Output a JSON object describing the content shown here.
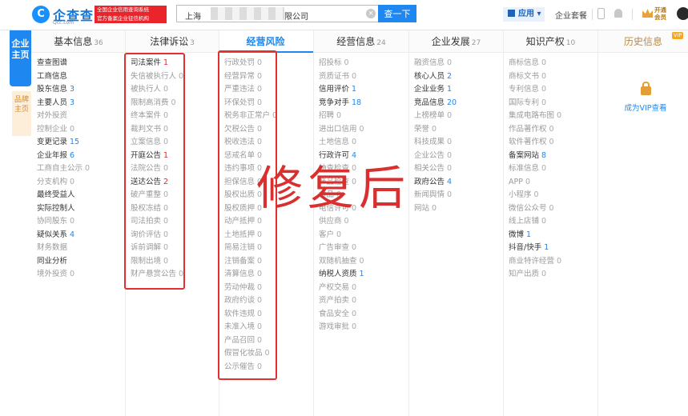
{
  "header": {
    "logo_mark": "C",
    "logo_text": "企查查",
    "logo_sub": "Qcc.com",
    "slogan_lines": [
      "全国企业信用查询系统",
      "官方备案企业征信机构"
    ],
    "search_value_prefix": "上海",
    "search_value_suffix": "有限公司",
    "search_button": "查一下",
    "app_menu": "应用",
    "package_link": "企业套餐",
    "vip_open": "开通会员"
  },
  "side_tabs": {
    "main": "企业主页",
    "brand": "品牌主页"
  },
  "columns": [
    {
      "title": "基本信息",
      "count": "36",
      "active": false,
      "items": [
        {
          "label": "查查图谱",
          "num": "",
          "dim": false,
          "style": ""
        },
        {
          "label": "工商信息",
          "num": "",
          "dim": false,
          "style": ""
        },
        {
          "label": "股东信息",
          "num": "3",
          "dim": false,
          "style": "hl"
        },
        {
          "label": "主要人员",
          "num": "3",
          "dim": false,
          "style": "hl"
        },
        {
          "label": "对外投资",
          "num": "",
          "dim": true,
          "style": ""
        },
        {
          "label": "控制企业",
          "num": "0",
          "dim": true,
          "style": ""
        },
        {
          "label": "变更记录",
          "num": "15",
          "dim": false,
          "style": "hl"
        },
        {
          "label": "企业年报",
          "num": "6",
          "dim": false,
          "style": "hl"
        },
        {
          "label": "工商自主公示",
          "num": "0",
          "dim": true,
          "style": ""
        },
        {
          "label": "分支机构",
          "num": "0",
          "dim": true,
          "style": ""
        },
        {
          "label": "最终受益人",
          "num": "",
          "dim": false,
          "style": ""
        },
        {
          "label": "实际控制人",
          "num": "",
          "dim": false,
          "style": ""
        },
        {
          "label": "协同股东",
          "num": "0",
          "dim": true,
          "style": ""
        },
        {
          "label": "疑似关系",
          "num": "4",
          "dim": false,
          "style": "hl"
        },
        {
          "label": "财务数据",
          "num": "",
          "dim": true,
          "style": ""
        },
        {
          "label": "同业分析",
          "num": "",
          "dim": false,
          "style": ""
        },
        {
          "label": "境外投资",
          "num": "0",
          "dim": true,
          "style": ""
        }
      ]
    },
    {
      "title": "法律诉讼",
      "count": "3",
      "active": false,
      "items": [
        {
          "label": "司法案件",
          "num": "1",
          "dim": false,
          "style": "red"
        },
        {
          "label": "失信被执行人",
          "num": "0",
          "dim": true,
          "style": ""
        },
        {
          "label": "被执行人",
          "num": "0",
          "dim": true,
          "style": ""
        },
        {
          "label": "限制高消费",
          "num": "0",
          "dim": true,
          "style": ""
        },
        {
          "label": "终本案件",
          "num": "0",
          "dim": true,
          "style": ""
        },
        {
          "label": "裁判文书",
          "num": "0",
          "dim": true,
          "style": ""
        },
        {
          "label": "立案信息",
          "num": "0",
          "dim": true,
          "style": ""
        },
        {
          "label": "开庭公告",
          "num": "1",
          "dim": false,
          "style": "red"
        },
        {
          "label": "法院公告",
          "num": "0",
          "dim": true,
          "style": ""
        },
        {
          "label": "送达公告",
          "num": "2",
          "dim": false,
          "style": "red"
        },
        {
          "label": "破产重整",
          "num": "0",
          "dim": true,
          "style": ""
        },
        {
          "label": "股权冻结",
          "num": "0",
          "dim": true,
          "style": ""
        },
        {
          "label": "司法拍卖",
          "num": "0",
          "dim": true,
          "style": ""
        },
        {
          "label": "询价评估",
          "num": "0",
          "dim": true,
          "style": ""
        },
        {
          "label": "诉前调解",
          "num": "0",
          "dim": true,
          "style": ""
        },
        {
          "label": "限制出境",
          "num": "0",
          "dim": true,
          "style": ""
        },
        {
          "label": "财产悬赏公告",
          "num": "0",
          "dim": true,
          "style": ""
        }
      ]
    },
    {
      "title": "经营风险",
      "count": "",
      "active": true,
      "items": [
        {
          "label": "行政处罚",
          "num": "0",
          "dim": true,
          "style": ""
        },
        {
          "label": "经营异常",
          "num": "0",
          "dim": true,
          "style": ""
        },
        {
          "label": "严重违法",
          "num": "0",
          "dim": true,
          "style": ""
        },
        {
          "label": "环保处罚",
          "num": "0",
          "dim": true,
          "style": ""
        },
        {
          "label": "税务非正常户",
          "num": "0",
          "dim": true,
          "style": ""
        },
        {
          "label": "欠税公告",
          "num": "0",
          "dim": true,
          "style": ""
        },
        {
          "label": "税收违法",
          "num": "0",
          "dim": true,
          "style": ""
        },
        {
          "label": "惩戒名单",
          "num": "0",
          "dim": true,
          "style": ""
        },
        {
          "label": "违约事项",
          "num": "0",
          "dim": true,
          "style": ""
        },
        {
          "label": "担保信息",
          "num": "0",
          "dim": true,
          "style": ""
        },
        {
          "label": "股权出质",
          "num": "0",
          "dim": true,
          "style": ""
        },
        {
          "label": "股权质押",
          "num": "0",
          "dim": true,
          "style": ""
        },
        {
          "label": "动产抵押",
          "num": "0",
          "dim": true,
          "style": ""
        },
        {
          "label": "土地抵押",
          "num": "0",
          "dim": true,
          "style": ""
        },
        {
          "label": "简易注销",
          "num": "0",
          "dim": true,
          "style": ""
        },
        {
          "label": "注销备案",
          "num": "0",
          "dim": true,
          "style": ""
        },
        {
          "label": "清算信息",
          "num": "0",
          "dim": true,
          "style": ""
        },
        {
          "label": "劳动仲裁",
          "num": "0",
          "dim": true,
          "style": ""
        },
        {
          "label": "政府约谈",
          "num": "0",
          "dim": true,
          "style": ""
        },
        {
          "label": "软件违规",
          "num": "0",
          "dim": true,
          "style": ""
        },
        {
          "label": "未准入境",
          "num": "0",
          "dim": true,
          "style": ""
        },
        {
          "label": "产品召回",
          "num": "0",
          "dim": true,
          "style": ""
        },
        {
          "label": "假冒化妆品",
          "num": "0",
          "dim": true,
          "style": ""
        },
        {
          "label": "公示催告",
          "num": "0",
          "dim": true,
          "style": ""
        }
      ]
    },
    {
      "title": "经营信息",
      "count": "24",
      "active": false,
      "items": [
        {
          "label": "招投标",
          "num": "0",
          "dim": true,
          "style": ""
        },
        {
          "label": "资质证书",
          "num": "0",
          "dim": true,
          "style": ""
        },
        {
          "label": "信用评价",
          "num": "1",
          "dim": false,
          "style": "hl"
        },
        {
          "label": "竞争对手",
          "num": "18",
          "dim": false,
          "style": "hl"
        },
        {
          "label": "招聘",
          "num": "0",
          "dim": true,
          "style": ""
        },
        {
          "label": "进出口信用",
          "num": "0",
          "dim": true,
          "style": ""
        },
        {
          "label": "土地信息",
          "num": "0",
          "dim": true,
          "style": ""
        },
        {
          "label": "行政许可",
          "num": "4",
          "dim": false,
          "style": "hl"
        },
        {
          "label": "抽查检查",
          "num": "0",
          "dim": true,
          "style": ""
        },
        {
          "label": "产品检查",
          "num": "0",
          "dim": true,
          "style": ""
        },
        {
          "label": "食品",
          "num": "0",
          "dim": true,
          "style": ""
        },
        {
          "label": "电信许可",
          "num": "0",
          "dim": true,
          "style": ""
        },
        {
          "label": "供应商",
          "num": "0",
          "dim": true,
          "style": ""
        },
        {
          "label": "客户",
          "num": "0",
          "dim": true,
          "style": ""
        },
        {
          "label": "广告审查",
          "num": "0",
          "dim": true,
          "style": ""
        },
        {
          "label": "双随机抽查",
          "num": "0",
          "dim": true,
          "style": ""
        },
        {
          "label": "纳税人资质",
          "num": "1",
          "dim": false,
          "style": "hl"
        },
        {
          "label": "产权交易",
          "num": "0",
          "dim": true,
          "style": ""
        },
        {
          "label": "资产拍卖",
          "num": "0",
          "dim": true,
          "style": ""
        },
        {
          "label": "食品安全",
          "num": "0",
          "dim": true,
          "style": ""
        },
        {
          "label": "游戏审批",
          "num": "0",
          "dim": true,
          "style": ""
        }
      ]
    },
    {
      "title": "企业发展",
      "count": "27",
      "active": false,
      "items": [
        {
          "label": "融资信息",
          "num": "0",
          "dim": true,
          "style": ""
        },
        {
          "label": "核心人员",
          "num": "2",
          "dim": false,
          "style": "hl"
        },
        {
          "label": "企业业务",
          "num": "1",
          "dim": false,
          "style": "hl"
        },
        {
          "label": "竞品信息",
          "num": "20",
          "dim": false,
          "style": "hl"
        },
        {
          "label": "上榜榜单",
          "num": "0",
          "dim": true,
          "style": ""
        },
        {
          "label": "荣誉",
          "num": "0",
          "dim": true,
          "style": ""
        },
        {
          "label": "科技成果",
          "num": "0",
          "dim": true,
          "style": ""
        },
        {
          "label": "企业公告",
          "num": "0",
          "dim": true,
          "style": ""
        },
        {
          "label": "相关公告",
          "num": "0",
          "dim": true,
          "style": ""
        },
        {
          "label": "政府公告",
          "num": "4",
          "dim": false,
          "style": "hl"
        },
        {
          "label": "新闻舆情",
          "num": "0",
          "dim": true,
          "style": ""
        },
        {
          "label": "网站",
          "num": "0",
          "dim": true,
          "style": ""
        }
      ]
    },
    {
      "title": "知识产权",
      "count": "10",
      "active": false,
      "items": [
        {
          "label": "商标信息",
          "num": "0",
          "dim": true,
          "style": ""
        },
        {
          "label": "商标文书",
          "num": "0",
          "dim": true,
          "style": ""
        },
        {
          "label": "专利信息",
          "num": "0",
          "dim": true,
          "style": ""
        },
        {
          "label": "国际专利",
          "num": "0",
          "dim": true,
          "style": ""
        },
        {
          "label": "集成电路布图",
          "num": "0",
          "dim": true,
          "style": ""
        },
        {
          "label": "作品著作权",
          "num": "0",
          "dim": true,
          "style": ""
        },
        {
          "label": "软件著作权",
          "num": "0",
          "dim": true,
          "style": ""
        },
        {
          "label": "备案网站",
          "num": "8",
          "dim": false,
          "style": "hl"
        },
        {
          "label": "标准信息",
          "num": "0",
          "dim": true,
          "style": ""
        },
        {
          "label": "APP",
          "num": "0",
          "dim": true,
          "style": ""
        },
        {
          "label": "小程序",
          "num": "0",
          "dim": true,
          "style": ""
        },
        {
          "label": "微信公众号",
          "num": "0",
          "dim": true,
          "style": ""
        },
        {
          "label": "线上店铺",
          "num": "0",
          "dim": true,
          "style": ""
        },
        {
          "label": "微博",
          "num": "1",
          "dim": false,
          "style": "hl"
        },
        {
          "label": "抖音/快手",
          "num": "1",
          "dim": false,
          "style": "hl"
        },
        {
          "label": "商业特许经营",
          "num": "0",
          "dim": true,
          "style": ""
        },
        {
          "label": "知产出质",
          "num": "0",
          "dim": true,
          "style": ""
        }
      ]
    }
  ],
  "history": {
    "title": "历史信息",
    "vip_tag": "VIP",
    "vip_link": "成为VIP查看"
  },
  "watermark": "修复后",
  "colors": {
    "brand_blue": "#1e87f0",
    "highlight_red": "#e23030",
    "vip_gold": "#f5a623"
  }
}
